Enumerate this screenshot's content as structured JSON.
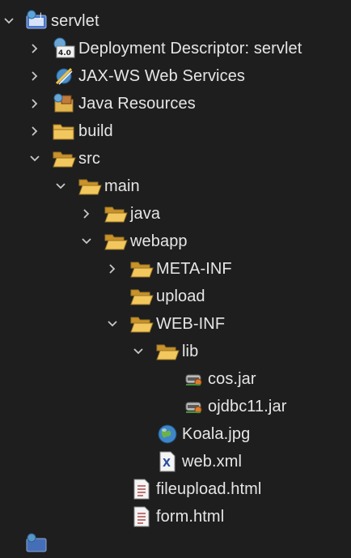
{
  "tree": {
    "nodes": [
      {
        "id": "servlet",
        "label": "servlet",
        "icon": "web-project-icon",
        "twisty": "expanded"
      },
      {
        "id": "deployment",
        "label": "Deployment Descriptor: servlet",
        "icon": "deployment-descriptor-icon",
        "twisty": "collapsed"
      },
      {
        "id": "jaxws",
        "label": "JAX-WS Web Services",
        "icon": "web-services-icon",
        "twisty": "collapsed"
      },
      {
        "id": "javares",
        "label": "Java Resources",
        "icon": "java-resources-icon",
        "twisty": "collapsed"
      },
      {
        "id": "build",
        "label": "build",
        "icon": "folder-icon",
        "twisty": "collapsed"
      },
      {
        "id": "src",
        "label": "src",
        "icon": "folder-open-icon",
        "twisty": "expanded"
      },
      {
        "id": "main",
        "label": "main",
        "icon": "folder-open-icon",
        "twisty": "expanded"
      },
      {
        "id": "java",
        "label": "java",
        "icon": "folder-icon",
        "twisty": "collapsed"
      },
      {
        "id": "webapp",
        "label": "webapp",
        "icon": "folder-open-icon",
        "twisty": "expanded"
      },
      {
        "id": "metainf",
        "label": "META-INF",
        "icon": "folder-icon",
        "twisty": "collapsed"
      },
      {
        "id": "upload",
        "label": "upload",
        "icon": "folder-icon",
        "twisty": "none"
      },
      {
        "id": "webinf",
        "label": "WEB-INF",
        "icon": "folder-open-icon",
        "twisty": "expanded"
      },
      {
        "id": "lib",
        "label": "lib",
        "icon": "folder-open-icon",
        "twisty": "expanded"
      },
      {
        "id": "cos",
        "label": "cos.jar",
        "icon": "jar-icon",
        "twisty": "none"
      },
      {
        "id": "ojdbc",
        "label": "ojdbc11.jar",
        "icon": "jar-icon",
        "twisty": "none"
      },
      {
        "id": "koala",
        "label": "Koala.jpg",
        "icon": "image-globe-icon",
        "twisty": "none"
      },
      {
        "id": "webxml",
        "label": "web.xml",
        "icon": "xml-file-icon",
        "twisty": "none"
      },
      {
        "id": "fileupload",
        "label": "fileupload.html",
        "icon": "html-file-icon",
        "twisty": "none"
      },
      {
        "id": "form",
        "label": "form.html",
        "icon": "html-file-icon",
        "twisty": "none"
      }
    ]
  },
  "colors": {
    "background": "#1e1e1e",
    "text": "#e6e6e6",
    "folder": "#e8b84a",
    "folder_dark": "#c9922a"
  }
}
